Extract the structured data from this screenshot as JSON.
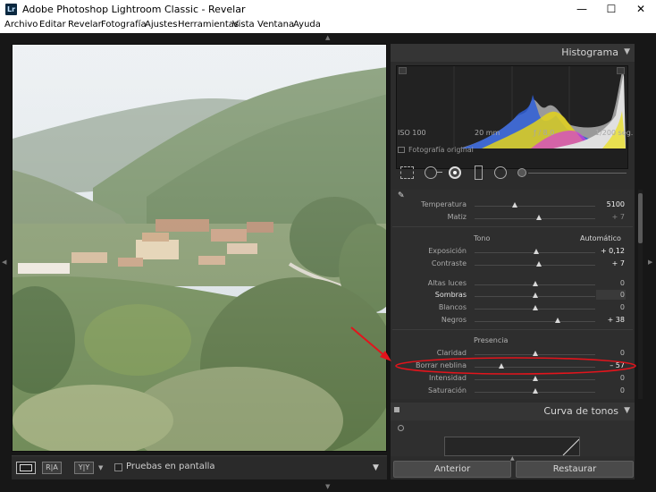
{
  "window": {
    "title": "Adobe Photoshop Lightroom Classic - Revelar",
    "logo_text": "Lr",
    "minimize": "—",
    "maximize": "☐",
    "close": "✕"
  },
  "menu": {
    "items": [
      "Archivo",
      "Editar",
      "Revelar",
      "Fotografía",
      "Ajustes",
      "Herramientas",
      "Vista",
      "Ventana",
      "Ayuda"
    ]
  },
  "histogram": {
    "title": "Histograma",
    "iso": "ISO 100",
    "focal": "20 mm",
    "aperture": "ƒ / 8,0",
    "shutter": "1/200 seg.",
    "original_photo_label": "Fotografía original"
  },
  "basic": {
    "temp_label": "Temperatura",
    "temp_value": "5100",
    "tint_label": "Matiz",
    "tint_value": "+ 7",
    "tone_label": "Tono",
    "auto_label": "Automático",
    "exposure_label": "Exposición",
    "exposure_value": "+ 0,12",
    "contrast_label": "Contraste",
    "contrast_value": "+ 7",
    "highlights_label": "Altas luces",
    "highlights_value": "0",
    "shadows_label": "Sombras",
    "shadows_value": "0",
    "whites_label": "Blancos",
    "whites_value": "0",
    "blacks_label": "Negros",
    "blacks_value": "+ 38",
    "presence_label": "Presencia",
    "clarity_label": "Claridad",
    "clarity_value": "0",
    "dehaze_label": "Borrar neblina",
    "dehaze_value": "– 57",
    "vibrance_label": "Intensidad",
    "vibrance_value": "0",
    "saturation_label": "Saturación",
    "saturation_value": "0"
  },
  "tone_curve": {
    "title": "Curva de tonos"
  },
  "buttons": {
    "previous": "Anterior",
    "reset": "Restaurar"
  },
  "toolbar": {
    "proofing_label": "Pruebas en pantalla",
    "ra_label": "R|A",
    "yy_label": "Y|Y"
  },
  "colors": {
    "annotation_red": "#e3141c",
    "panel_bg": "#2c2c2c"
  },
  "slider_levels": {
    "temperature": 0.33,
    "tint": 0.53,
    "exposure": 0.51,
    "contrast": 0.53,
    "highlights": 0.5,
    "shadows": 0.5,
    "whites": 0.5,
    "blacks": 0.69,
    "clarity": 0.5,
    "dehaze": 0.22,
    "vibrance": 0.5,
    "saturation": 0.5
  }
}
